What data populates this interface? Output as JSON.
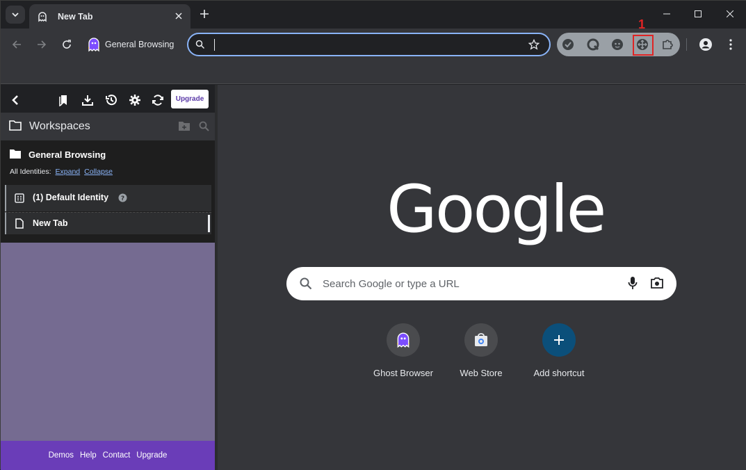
{
  "tab": {
    "title": "New Tab"
  },
  "toolbar": {
    "profile_label": "General Browsing",
    "omnibox_value": "",
    "highlight_number": "1"
  },
  "side_panel": {
    "upgrade_label": "Upgrade",
    "workspaces_title": "Workspaces",
    "group_title": "General Browsing",
    "identities_label": "All Identities:",
    "expand_label": "Expand",
    "collapse_label": "Collapse",
    "identity_label": "(1) Default Identity",
    "tab_label": "New Tab",
    "footer_links": [
      "Demos",
      "Help",
      "Contact",
      "Upgrade"
    ]
  },
  "ntp": {
    "logo_text": "Google",
    "search_placeholder": "Search Google or type a URL",
    "shortcuts": [
      {
        "label": "Ghost Browser",
        "icon": "ghost-icon"
      },
      {
        "label": "Web Store",
        "icon": "webstore-icon"
      },
      {
        "label": "Add shortcut",
        "icon": "plus-icon"
      }
    ]
  },
  "colors": {
    "accent_blue": "#8ab4f8",
    "footer_purple": "#6a3db8",
    "panel_purple": "#756b91",
    "highlight_red": "#e02424"
  }
}
